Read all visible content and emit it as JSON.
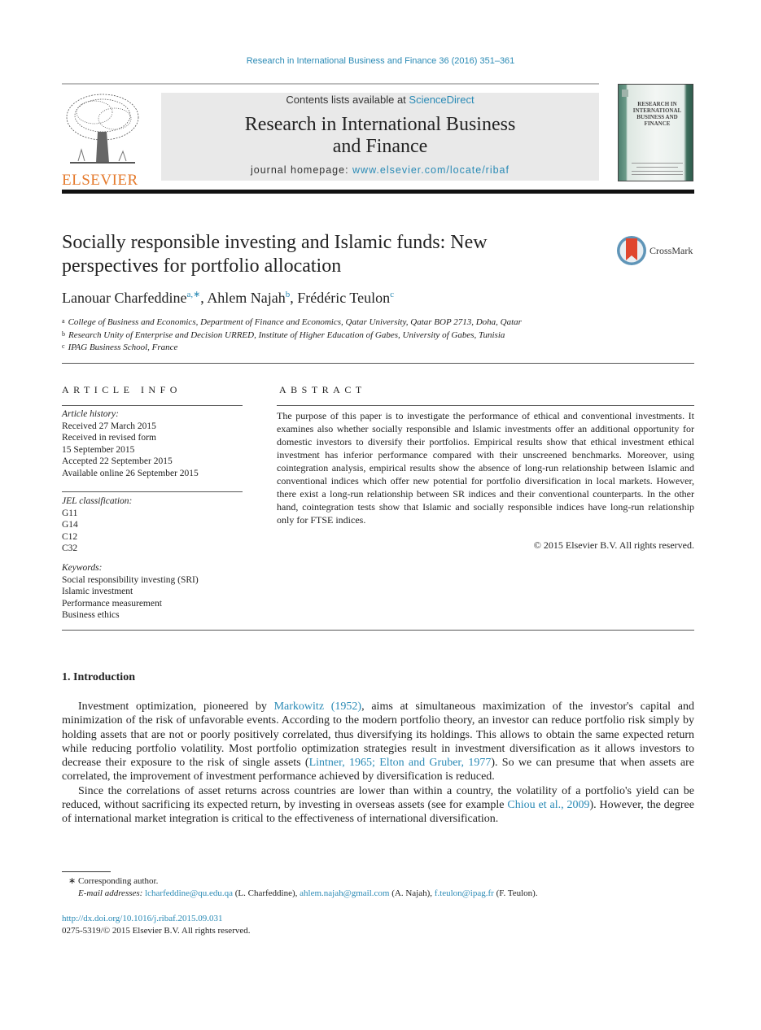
{
  "header": {
    "running_head": "Research in International Business and Finance 36 (2016) 351–361",
    "contents_prefix": "Contents lists available at ",
    "contents_link": "ScienceDirect",
    "journal_title_line1": "Research in International Business",
    "journal_title_line2": "and Finance",
    "homepage_prefix": "journal homepage: ",
    "homepage_url": "www.elsevier.com/locate/ribaf",
    "publisher_logo_text": "ELSEVIER",
    "cover_title": "RESEARCH IN INTERNATIONAL BUSINESS AND FINANCE",
    "crossmark_label": "CrossMark"
  },
  "article": {
    "title": "Socially responsible investing and Islamic funds: New perspectives for portfolio allocation",
    "authors": [
      {
        "name": "Lanouar Charfeddine",
        "sup": "a,∗"
      },
      {
        "name": "Ahlem Najah",
        "sup": "b"
      },
      {
        "name": "Frédéric Teulon",
        "sup": "c"
      }
    ],
    "affiliations": [
      {
        "mark": "a",
        "text": "College of Business and Economics, Department of Finance and Economics, Qatar University, Qatar BOP 2713, Doha, Qatar"
      },
      {
        "mark": "b",
        "text": "Research Unity of Enterprise and Decision URRED, Institute of Higher Education of Gabes, University of Gabes, Tunisia"
      },
      {
        "mark": "c",
        "text": "IPAG Business School, France"
      }
    ]
  },
  "article_info": {
    "heading": "ARTICLE INFO",
    "history_label": "Article history:",
    "history": [
      "Received 27 March 2015",
      "Received in revised form",
      "15 September 2015",
      "Accepted 22 September 2015",
      "Available online 26 September 2015"
    ],
    "jel_label": "JEL classification:",
    "jel": [
      "G11",
      "G14",
      "C12",
      "C32"
    ],
    "keywords_label": "Keywords:",
    "keywords": [
      "Social responsibility investing (SRI)",
      "Islamic investment",
      "Performance measurement",
      "Business ethics"
    ]
  },
  "abstract": {
    "heading": "ABSTRACT",
    "text": "The purpose of this paper is to investigate the performance of ethical and conventional investments. It examines also whether socially responsible and Islamic investments offer an additional opportunity for domestic investors to diversify their portfolios. Empirical results show that ethical investment ethical investment has inferior performance compared with their unscreened benchmarks. Moreover, using cointegration analysis, empirical results show the absence of long-run relationship between Islamic and conventional indices which offer new potential for portfolio diversification in local markets. However, there exist a long-run relationship between SR indices and their conventional counterparts. In the other hand, cointegration tests show that Islamic and socially responsible indices have long-run relationship only for FTSE indices.",
    "copyright": "© 2015 Elsevier B.V. All rights reserved."
  },
  "introduction": {
    "heading": "1.  Introduction",
    "p1_a": "Investment optimization, pioneered by ",
    "p1_link1": "Markowitz (1952)",
    "p1_b": ", aims at simultaneous maximization of the investor's capital and minimization of the risk of unfavorable events. According to the modern portfolio theory, an investor can reduce portfolio risk simply by holding assets that are not or poorly positively correlated, thus diversifying its holdings. This allows to obtain the same expected return while reducing portfolio volatility. Most portfolio optimization strategies result in investment diversification as it allows investors to decrease their exposure to the risk of single assets (",
    "p1_link2": "Lintner, 1965; Elton and Gruber, 1977",
    "p1_c": "). So we can presume that when assets are correlated, the improvement of investment performance achieved by diversification is reduced.",
    "p2_a": "Since the correlations of asset returns across countries are lower than within a country, the volatility of a portfolio's yield can be reduced, without sacrificing its expected return, by investing in overseas assets (see for example ",
    "p2_link": "Chiou et al., 2009",
    "p2_b": "). However, the degree of international market integration is critical to the effectiveness of international diversification."
  },
  "footnotes": {
    "corresponding": "∗  Corresponding author.",
    "email_label": "E-mail addresses: ",
    "emails": [
      {
        "addr": "lcharfeddine@qu.edu.qa",
        "who": " (L. Charfeddine), "
      },
      {
        "addr": "ahlem.najah@gmail.com",
        "who": " (A. Najah), "
      },
      {
        "addr": "f.teulon@ipag.fr",
        "who": " (F. Teulon)."
      }
    ],
    "doi": "http://dx.doi.org/10.1016/j.ribaf.2015.09.031",
    "issn": "0275-5319/© 2015 Elsevier B.V. All rights reserved."
  }
}
